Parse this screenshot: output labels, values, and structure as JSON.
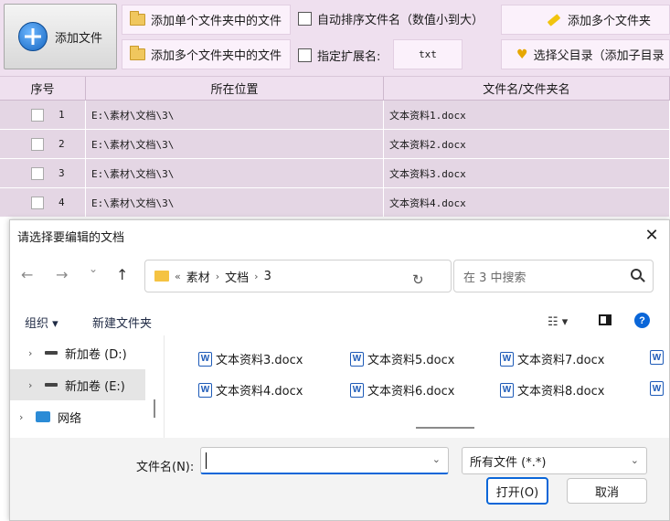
{
  "toolbar": {
    "add_file": "添加文件",
    "add_single_folder": "添加单个文件夹中的文件",
    "add_multi_folder_files": "添加多个文件夹中的文件",
    "auto_sort": "自动排序文件名（数值小到大）",
    "specify_ext": "指定扩展名:",
    "ext_value": "txt",
    "add_multi_folders": "添加多个文件夹",
    "choose_parent": "选择父目录（添加子目录"
  },
  "table": {
    "headers": [
      "序号",
      "所在位置",
      "文件名/文件夹名"
    ],
    "rows": [
      {
        "index": "1",
        "location": "E:\\素材\\文档\\3\\",
        "name": "文本资料1.docx"
      },
      {
        "index": "2",
        "location": "E:\\素材\\文档\\3\\",
        "name": "文本资料2.docx"
      },
      {
        "index": "3",
        "location": "E:\\素材\\文档\\3\\",
        "name": "文本资料3.docx"
      },
      {
        "index": "4",
        "location": "E:\\素材\\文档\\3\\",
        "name": "文本资料4.docx"
      }
    ]
  },
  "dialog": {
    "title": "请选择要编辑的文档",
    "close": "✕",
    "nav": {
      "back": "←",
      "forward": "→",
      "recent": "⌄",
      "up": "↑"
    },
    "address": {
      "prefix": "«",
      "parts": [
        "素材",
        "文档",
        "3"
      ],
      "sep": "›"
    },
    "search_placeholder": "在 3 中搜索",
    "commands": {
      "organize": "组织 ▾",
      "new_folder": "新建文件夹"
    },
    "help": "?",
    "view": "☷ ▾",
    "nav_pane": [
      {
        "label": "新加卷 (D:)",
        "type": "drive",
        "selected": false
      },
      {
        "label": "新加卷 (E:)",
        "type": "drive",
        "selected": true
      },
      {
        "label": "网络",
        "type": "network",
        "selected": false
      }
    ],
    "files": [
      "文本资料3.docx",
      "文本资料5.docx",
      "文本资料7.docx",
      "文本资料4.docx",
      "文本资料6.docx",
      "文本资料8.docx"
    ],
    "file_icon_letter": "W",
    "filename_label": "文件名(N):",
    "filename_value": "",
    "filetype": "所有文件 (*.*)",
    "open_button": "打开(O)",
    "cancel_button": "取消"
  },
  "colors": {
    "toolbar_bg": "#efe0ef",
    "row_bg": "#e4d6e4",
    "accent": "#0a66d8"
  }
}
